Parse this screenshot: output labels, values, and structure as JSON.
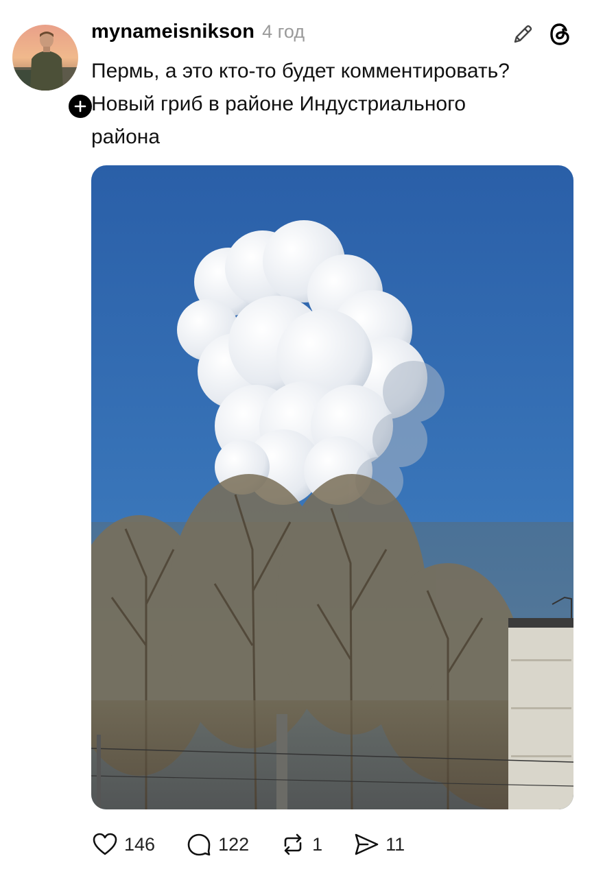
{
  "post": {
    "username": "mynameisnikson",
    "timestamp": "4 год",
    "text_lines": [
      "Пермь, а это кто-то будет комментировать?",
      "Новый гриб в районе Индустриального",
      "района"
    ]
  },
  "header_icons": [
    "edit-icon",
    "threads-logo-icon"
  ],
  "photo": {
    "subject": "white smoke cloud above bare trees",
    "sky_color": "#2f6bb1"
  },
  "actions": {
    "likes": "146",
    "comments": "122",
    "reposts": "1",
    "shares": "11"
  },
  "colors": {
    "text": "#000000",
    "muted": "#9a9a9a",
    "background": "#ffffff"
  }
}
